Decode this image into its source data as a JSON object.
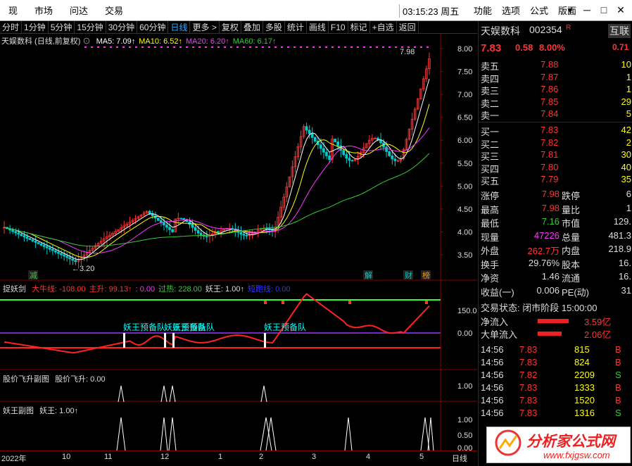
{
  "topbar": {
    "menus": [
      "现",
      "市场",
      "问达",
      "交易"
    ],
    "clock": "03:15:23 周五",
    "right_menus": [
      "功能",
      "选项",
      "公式",
      "版面"
    ],
    "win": [
      "▾",
      "─",
      "□",
      "✕"
    ]
  },
  "toolbar": {
    "periods": [
      "分时",
      "1分钟",
      "5分钟",
      "15分钟",
      "30分钟",
      "60分钟",
      "日线",
      "更多 >"
    ],
    "tools": [
      "复权",
      "叠加",
      "多股",
      "统计",
      "画线",
      "F10",
      "标记",
      "+自选",
      "返回"
    ],
    "active": "日线"
  },
  "main": {
    "title": "天娱数科 (日线,前复权)",
    "ma": [
      {
        "k": "MA5:",
        "v": "7.09↑",
        "c": "#fff"
      },
      {
        "k": "MA10:",
        "v": "6.52↑",
        "c": "#ff0"
      },
      {
        "k": "MA20:",
        "v": "6.20↑",
        "c": "#f3f"
      },
      {
        "k": "MA60:",
        "v": "6.17↑",
        "c": "#3c3"
      }
    ],
    "yticks": [
      "8.00",
      "7.50",
      "7.00",
      "6.50",
      "6.00",
      "5.50",
      "5.00",
      "4.50",
      "4.00",
      "3.50"
    ],
    "high_label": "7.98",
    "low_label": "3.20",
    "markers": [
      "减",
      "解",
      "财",
      "榜"
    ]
  },
  "sub1": {
    "title": "捉妖剑",
    "items": [
      {
        "t": "大牛线: -108.00",
        "c": "#f33"
      },
      {
        "t": "主升: 99.13↑",
        "c": "#f33"
      },
      {
        "t": ": 0.00",
        "c": "#f3f"
      },
      {
        "t": "过热: 228.00",
        "c": "#3c3"
      },
      {
        "t": "妖王: 1.00↑",
        "c": "#ddd"
      },
      {
        "t": "短跑线: 0.00",
        "c": "#33f"
      }
    ],
    "yticks": [
      "150.0",
      "0.00"
    ],
    "annots": [
      "妖王预备队",
      "妖王预备队",
      "妖王预备队",
      "妖王预备队"
    ]
  },
  "sub2": {
    "title": "股价飞升副图",
    "items": [
      {
        "t": "股价飞升: 0.00",
        "c": "#ddd"
      }
    ],
    "yticks": [
      "1.00"
    ]
  },
  "sub3": {
    "title": "妖王副图",
    "items": [
      {
        "t": "妖王: 1.00↑",
        "c": "#ddd"
      }
    ],
    "yticks": [
      "1.00",
      "0.50",
      "0.00"
    ]
  },
  "xaxis": [
    "2022年",
    "10",
    "11",
    "12",
    "1",
    "2",
    "3",
    "4",
    "5",
    "日线"
  ],
  "stock": {
    "name": "天娱数科",
    "code": "002354",
    "flag": "R",
    "side_btn": "互联",
    "price": "7.83",
    "chg": "0.58",
    "pct": "8.00%",
    "side_val": "0.71"
  },
  "asks": [
    {
      "l": "卖五",
      "p": "7.88",
      "v": "10"
    },
    {
      "l": "卖四",
      "p": "7.87",
      "v": "1"
    },
    {
      "l": "卖三",
      "p": "7.86",
      "v": "1"
    },
    {
      "l": "卖二",
      "p": "7.85",
      "v": "29"
    },
    {
      "l": "卖一",
      "p": "7.84",
      "v": "5"
    }
  ],
  "bids": [
    {
      "l": "买一",
      "p": "7.83",
      "v": "42"
    },
    {
      "l": "买二",
      "p": "7.82",
      "v": "2"
    },
    {
      "l": "买三",
      "p": "7.81",
      "v": "30"
    },
    {
      "l": "买四",
      "p": "7.80",
      "v": "40"
    },
    {
      "l": "买五",
      "p": "7.79",
      "v": "35"
    }
  ],
  "stats": [
    {
      "a": "涨停",
      "b": "7.98",
      "c": "跌停",
      "d": "6"
    },
    {
      "a": "最高",
      "b": "7.98",
      "c": "量比",
      "d": "1"
    },
    {
      "a": "最低",
      "b": "7.16",
      "c": "市值",
      "d": "129."
    },
    {
      "a": "现量",
      "b": "47226",
      "c": "总量",
      "d": "481.3"
    },
    {
      "a": "外盘",
      "b": "262.7万",
      "c": "内盘",
      "d": "218.9"
    },
    {
      "a": "换手",
      "b": "29.76%",
      "c": "股本",
      "d": "16."
    },
    {
      "a": "净资",
      "b": "1.46",
      "c": "流通",
      "d": "16."
    },
    {
      "a": "收益(一)",
      "b": "0.006",
      "c": "PE(动)",
      "d": "31"
    }
  ],
  "trade_state": {
    "label": "交易状态: 闭市阶段 15:00:00"
  },
  "flows": [
    {
      "l": "净流入",
      "v": "3.59亿"
    },
    {
      "l": "大单流入",
      "v": "2.06亿"
    }
  ],
  "ticks": [
    {
      "t": "14:56",
      "p": "7.83",
      "v": "815",
      "s": "B"
    },
    {
      "t": "14:56",
      "p": "7.83",
      "v": "824",
      "s": "B"
    },
    {
      "t": "14:56",
      "p": "7.82",
      "v": "2209",
      "s": "S"
    },
    {
      "t": "14:56",
      "p": "7.83",
      "v": "1333",
      "s": "B"
    },
    {
      "t": "14:56",
      "p": "7.83",
      "v": "1520",
      "s": "B"
    },
    {
      "t": "14:56",
      "p": "7.83",
      "v": "1316",
      "s": "S"
    }
  ],
  "logo": {
    "cn": "分析家公式网",
    "url": "www.fxjgsw.com"
  }
}
